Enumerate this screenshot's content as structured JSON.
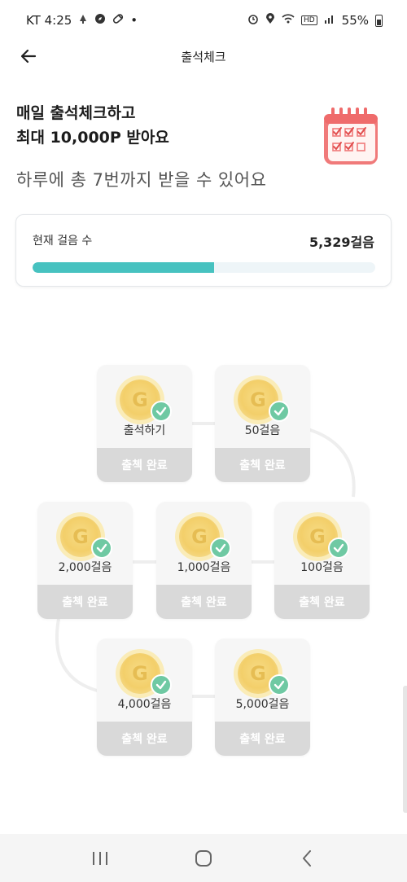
{
  "status_bar": {
    "carrier_time": "KT 4:25",
    "dot": "•",
    "network": "HD",
    "battery": "55%",
    "left_icons": [
      "notification-icon",
      "compass-icon",
      "pill-icon"
    ],
    "right_icons": [
      "alarm-icon",
      "location-icon",
      "wifi-icon",
      "signal-icon",
      "battery-icon"
    ]
  },
  "header": {
    "title": "출석체크"
  },
  "intro": {
    "headline": "매일 출석체크하고\n최대 10,000P 받아요",
    "subline": "하루에 총 7번까지 받을 수 있어요"
  },
  "steps": {
    "label": "현재 걸음 수",
    "value": "5,329걸음",
    "progress": 0.53
  },
  "rewards": [
    {
      "label": "출석하기",
      "status": "출첵 완료",
      "done": true
    },
    {
      "label": "50걸음",
      "status": "출첵 완료",
      "done": true
    },
    {
      "label": "100걸음",
      "status": "출첵 완료",
      "done": true
    },
    {
      "label": "1,000걸음",
      "status": "출첵 완료",
      "done": true
    },
    {
      "label": "2,000걸음",
      "status": "출첵 완료",
      "done": true
    },
    {
      "label": "4,000걸음",
      "status": "출첵 완료",
      "done": true
    },
    {
      "label": "5,000걸음",
      "status": "출첵 완료",
      "done": true
    }
  ],
  "coin_letter": "G",
  "colors": {
    "accent": "#47c2c0",
    "check": "#6fc9a3",
    "coin": "#f3cf6a",
    "status_done": "#d9d9d9"
  },
  "nav": {
    "icons": [
      "recent-apps-icon",
      "home-icon",
      "back-icon"
    ]
  }
}
